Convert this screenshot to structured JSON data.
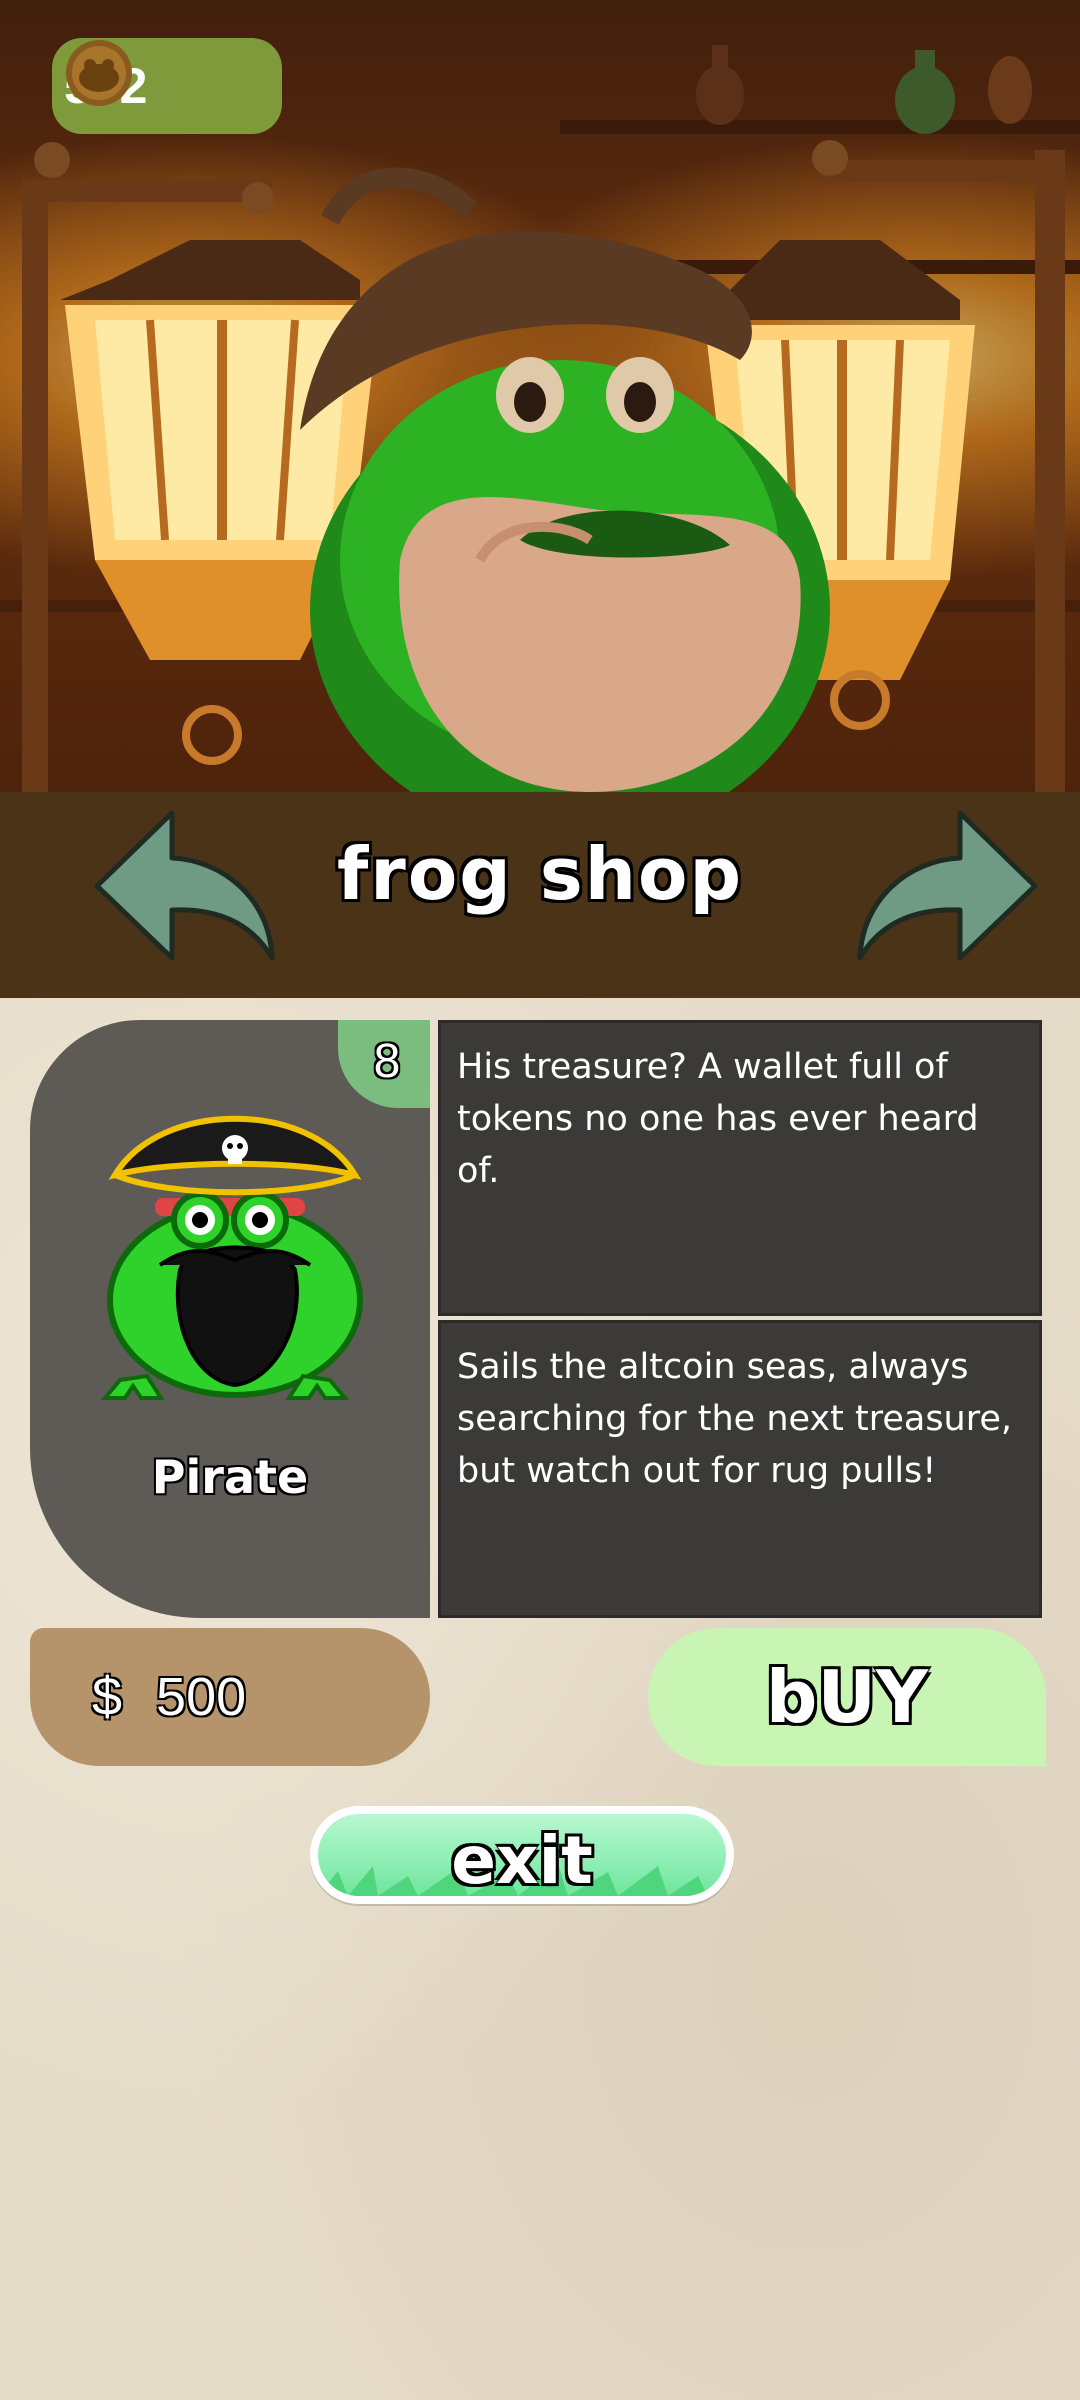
{
  "hud": {
    "coins": "562",
    "coin_icon": "frog-coin-icon"
  },
  "header": {
    "title": "frog shop",
    "prev_icon": "curved-arrow-left-icon",
    "next_icon": "curved-arrow-right-icon"
  },
  "frog": {
    "name": "Pirate",
    "level": "8",
    "description_1": "His treasure? A wallet full of tokens no one has ever heard of.",
    "description_2": "Sails the altcoin seas, always searching for the next treasure, but watch out for rug pulls!"
  },
  "price": {
    "symbol": "$",
    "value": "500"
  },
  "buttons": {
    "buy": "bUY",
    "exit": "exit"
  },
  "colors": {
    "title_bar": "#4b3318",
    "coin_pill": "#7f9a3a",
    "card_bg": "#5e5a55",
    "badge": "#7bbd7f",
    "desc_bg": "#3b3a38",
    "price_pill": "#b5946c",
    "buy_button": "#c9f5b4",
    "exit_button": "#90efb6",
    "arrows": "#6f9b85"
  }
}
